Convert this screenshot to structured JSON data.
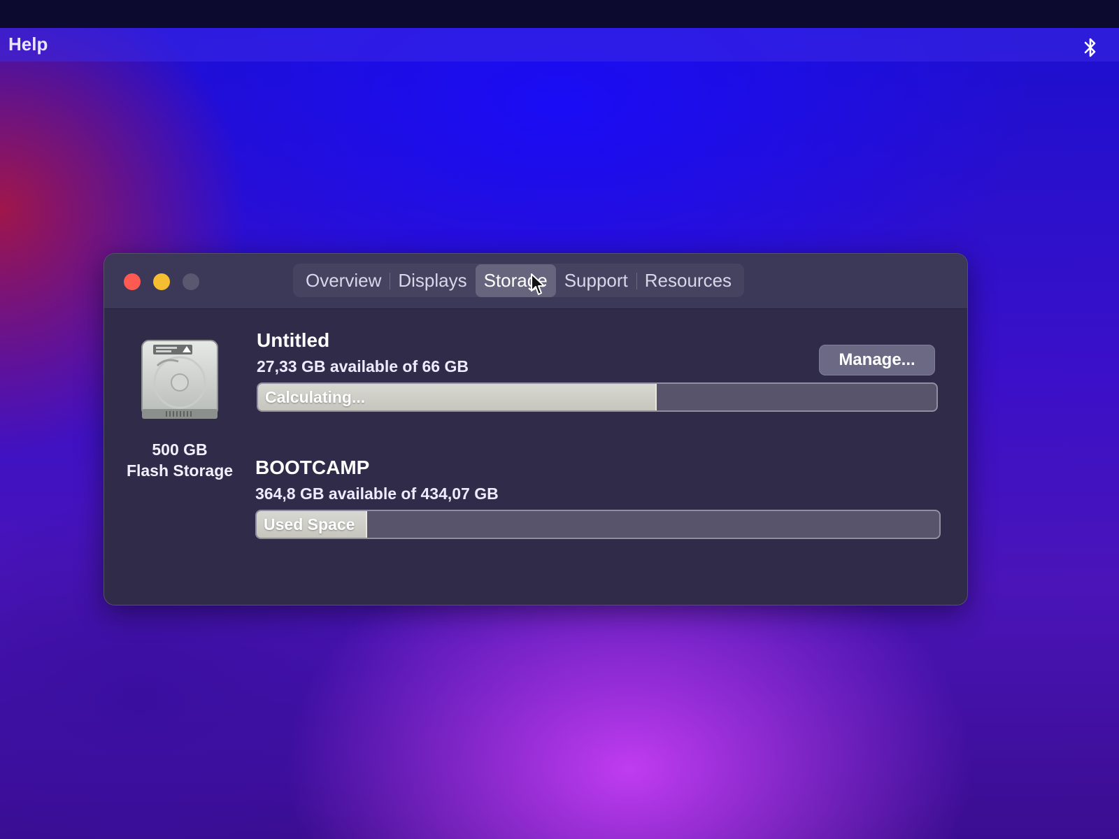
{
  "menubar": {
    "help_label": "Help",
    "right_icon": "bluetooth-icon"
  },
  "window": {
    "controls": [
      "close",
      "minimize",
      "zoom"
    ],
    "tabs": [
      {
        "label": "Overview",
        "active": false
      },
      {
        "label": "Displays",
        "active": false
      },
      {
        "label": "Storage",
        "active": true
      },
      {
        "label": "Support",
        "active": false
      },
      {
        "label": "Resources",
        "active": false
      }
    ],
    "disk": {
      "icon": "hard-drive-icon",
      "capacity": "500 GB",
      "type": "Flash Storage"
    },
    "volumes": [
      {
        "name": "Untitled",
        "info": "27,33 GB available of 66 GB",
        "bar_label": "Calculating...",
        "used_fraction": 0.586
      },
      {
        "name": "BOOTCAMP",
        "info": "364,8 GB available of 434,07 GB",
        "bar_label": "Used Space",
        "used_fraction": 0.16
      }
    ],
    "manage_label": "Manage..."
  },
  "colors": {
    "close": "#ff5a52",
    "minimize": "#f5be30",
    "zoom_disabled": "#5a5870",
    "bar_fill": "#d0d0ca"
  }
}
